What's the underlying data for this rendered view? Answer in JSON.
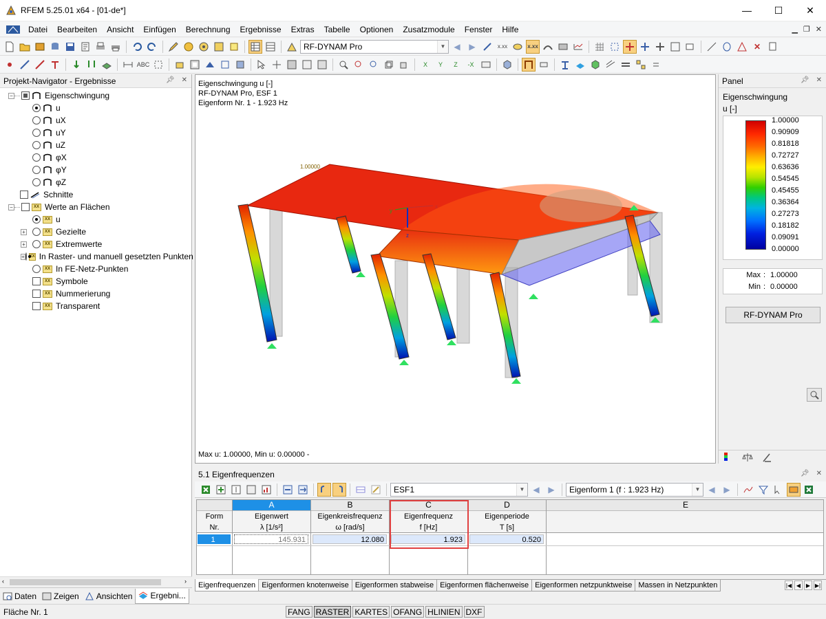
{
  "window": {
    "title": "RFEM 5.25.01 x64 - [01-de*]",
    "minimize": "—",
    "maximize": "☐",
    "close": "✕"
  },
  "menu": [
    "Datei",
    "Bearbeiten",
    "Ansicht",
    "Einfügen",
    "Berechnung",
    "Ergebnisse",
    "Extras",
    "Tabelle",
    "Optionen",
    "Zusatzmodule",
    "Fenster",
    "Hilfe"
  ],
  "toolbar": {
    "module_combo": "RF-DYNAM Pro"
  },
  "navigator": {
    "title": "Projekt-Navigator - Ergebnisse",
    "items": [
      "Eigenschwingung",
      "u",
      "uX",
      "uY",
      "uZ",
      "φX",
      "φY",
      "φZ",
      "Schnitte",
      "Werte an Flächen",
      "u",
      "Gezielte",
      "Extremwerte",
      "In Raster- und manuell gesetzten Punkten",
      "In FE-Netz-Punkten",
      "Symbole",
      "Nummerierung",
      "Transparent"
    ],
    "tabs": [
      "Daten",
      "Zeigen",
      "Ansichten",
      "Ergebni..."
    ]
  },
  "viewport": {
    "info_line1": "Eigenschwingung u [-]",
    "info_line2": "RF-DYNAM Pro, ESF 1",
    "info_line3": "Eigenform Nr. 1 - 1.923 Hz",
    "bottom": "Max u: 1.00000, Min u: 0.00000 -",
    "max_label": "1.00000",
    "axis_x": "x",
    "axis_y": "y",
    "axis_z": "z"
  },
  "panel": {
    "title": "Panel",
    "subtitle": "Eigenschwingung",
    "unit": "u [-]",
    "scale": [
      "1.00000",
      "0.90909",
      "0.81818",
      "0.72727",
      "0.63636",
      "0.54545",
      "0.45455",
      "0.36364",
      "0.27273",
      "0.18182",
      "0.09091",
      "0.00000"
    ],
    "max_key": "Max",
    "max_sep": ":",
    "max_val": "1.00000",
    "min_key": "Min",
    "min_sep": ":",
    "min_val": "0.00000",
    "button": "RF-DYNAM Pro"
  },
  "table": {
    "title": "5.1 Eigenfrequenzen",
    "combo_esf": "ESF1",
    "combo_mode": "Eigenform 1 (f : 1.923 Hz)",
    "columns": [
      {
        "letter": "",
        "h1": "Form",
        "h2": "Nr."
      },
      {
        "letter": "A",
        "h1": "Eigenwert",
        "h2": "λ [1/s²]"
      },
      {
        "letter": "B",
        "h1": "Eigenkreisfrequenz",
        "h2": "ω [rad/s]"
      },
      {
        "letter": "C",
        "h1": "Eigenfrequenz",
        "h2": "f [Hz]"
      },
      {
        "letter": "D",
        "h1": "Eigenperiode",
        "h2": "T [s]"
      },
      {
        "letter": "E",
        "h1": "",
        "h2": ""
      }
    ],
    "row": {
      "nr": "1",
      "lambda": "145.931",
      "omega": "12.080",
      "f": "1.923",
      "T": "0.520"
    },
    "tabs": [
      "Eigenfrequenzen",
      "Eigenformen knotenweise",
      "Eigenformen stabweise",
      "Eigenformen flächenweise",
      "Eigenformen netzpunktweise",
      "Massen in Netzpunkten"
    ]
  },
  "statusbar": {
    "left": "Fläche Nr. 1",
    "buttons": [
      "FANG",
      "RASTER",
      "KARTES",
      "OFANG",
      "HLINIEN",
      "DXF"
    ]
  }
}
